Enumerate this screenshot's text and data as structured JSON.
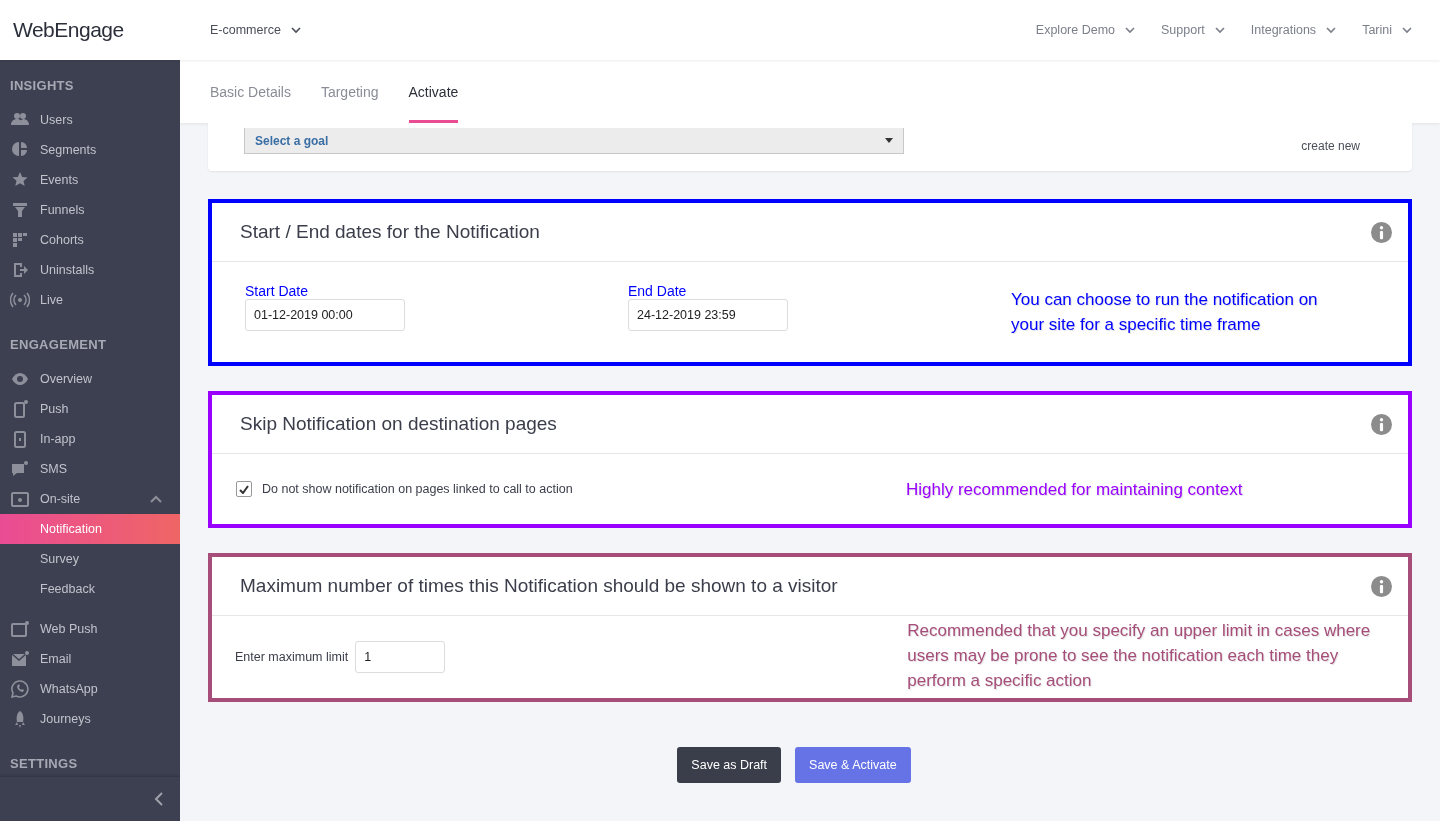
{
  "header": {
    "logo": "WebEngage",
    "project": "E-commerce",
    "menus": [
      "Explore Demo",
      "Support",
      "Integrations",
      "Tarini"
    ]
  },
  "sidebar": {
    "groups": [
      {
        "heading": "INSIGHTS",
        "items": [
          {
            "label": "Users",
            "selected": false
          },
          {
            "label": "Segments",
            "selected": false
          },
          {
            "label": "Events",
            "selected": false
          },
          {
            "label": "Funnels",
            "selected": false
          },
          {
            "label": "Cohorts",
            "selected": false
          },
          {
            "label": "Uninstalls",
            "selected": false
          },
          {
            "label": "Live",
            "selected": false
          }
        ]
      },
      {
        "heading": "ENGAGEMENT",
        "items": [
          {
            "label": "Overview",
            "selected": false
          },
          {
            "label": "Push",
            "selected": false
          },
          {
            "label": "In-app",
            "selected": false
          },
          {
            "label": "SMS",
            "selected": false
          },
          {
            "label": "On-site",
            "selected": false,
            "expanded": true,
            "children": [
              {
                "label": "Notification",
                "selected": true
              },
              {
                "label": "Survey",
                "selected": false
              },
              {
                "label": "Feedback",
                "selected": false
              }
            ]
          },
          {
            "label": "Web Push",
            "selected": false
          },
          {
            "label": "Email",
            "selected": false
          },
          {
            "label": "WhatsApp",
            "selected": false
          },
          {
            "label": "Journeys",
            "selected": false
          }
        ]
      },
      {
        "heading": "SETTINGS"
      }
    ]
  },
  "tabs": [
    {
      "label": "Basic Details",
      "selected": false
    },
    {
      "label": "Targeting",
      "selected": false
    },
    {
      "label": "Activate",
      "selected": true
    }
  ],
  "goal": {
    "placeholder": "Select a goal",
    "link": "create new"
  },
  "sections": [
    {
      "kind": "dates",
      "title": "Start / End dates for the Notification",
      "color": "#0000ff",
      "fields": [
        {
          "label": "Start Date",
          "value": "01-12-2019 00:00"
        },
        {
          "label": "End Date",
          "value": "24-12-2019 23:59"
        }
      ],
      "note": "You can choose to run the notification on your site for a specific time frame"
    },
    {
      "kind": "checkbox",
      "title": "Skip Notification on destination pages",
      "color": "#9900ff",
      "checkbox": {
        "label": "Do not show notification on pages linked to call to action",
        "checked": true
      },
      "note": "Highly recommended for maintaining context"
    },
    {
      "kind": "limit",
      "title": "Maximum number of times this Notification should be shown to a visitor",
      "color": "#a64d79",
      "field": {
        "label": "Enter maximum limit",
        "value": "1"
      },
      "note": "Recommended that you specify an upper limit in cases where users may be prone to see the notification each time they perform a specific action"
    }
  ],
  "buttons": [
    {
      "label": "Save as Draft",
      "kind": "secondary"
    },
    {
      "label": "Save & Activate",
      "kind": "primary"
    }
  ]
}
